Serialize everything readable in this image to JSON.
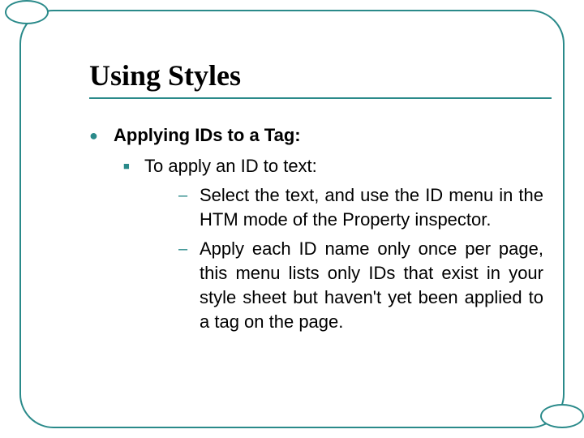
{
  "title": "Using Styles",
  "content": {
    "heading": "Applying IDs to a Tag:",
    "subheading": "To apply an ID to text:",
    "items": [
      "Select the text, and use the ID menu in the HTM mode of the Property inspector.",
      "Apply each ID name only once per page, this menu lists only IDs that exist in your style sheet but haven't yet been applied to a tag on the page."
    ]
  },
  "bullets": {
    "l1": "●",
    "l2": "■",
    "l3": "–"
  }
}
